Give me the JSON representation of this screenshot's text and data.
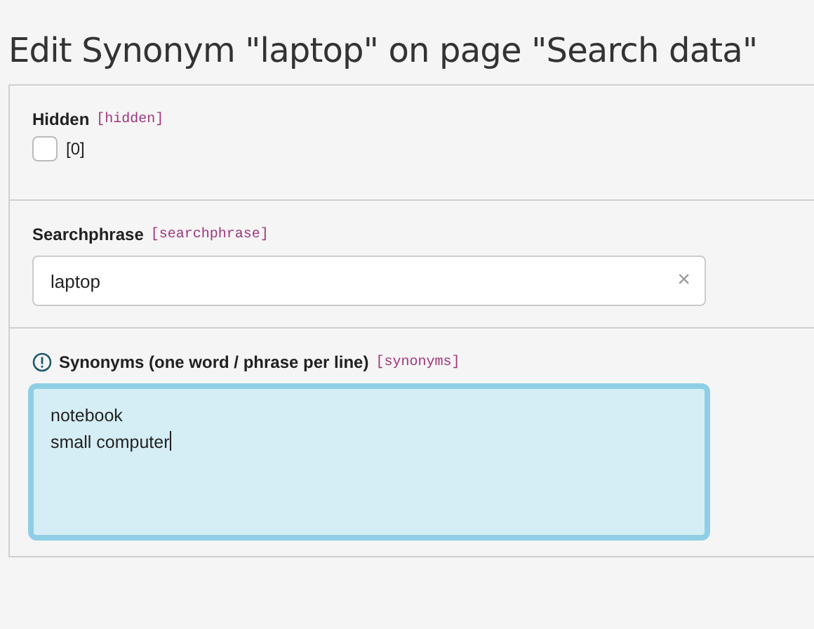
{
  "page_title": "Edit Synonym \"laptop\" on page \"Search data\"",
  "fields": [
    {
      "kind": "checkbox",
      "label": "Hidden",
      "key": "[hidden]",
      "checked": false,
      "value_label": "[0]"
    },
    {
      "kind": "text",
      "label": "Searchphrase",
      "key": "[searchphrase]",
      "value": "laptop",
      "clear": "×"
    },
    {
      "kind": "textarea",
      "label": "Synonyms (one word / phrase per line)",
      "key": "[synonyms]",
      "value": "notebook\nsmall computer",
      "focused": true,
      "info": true
    }
  ]
}
